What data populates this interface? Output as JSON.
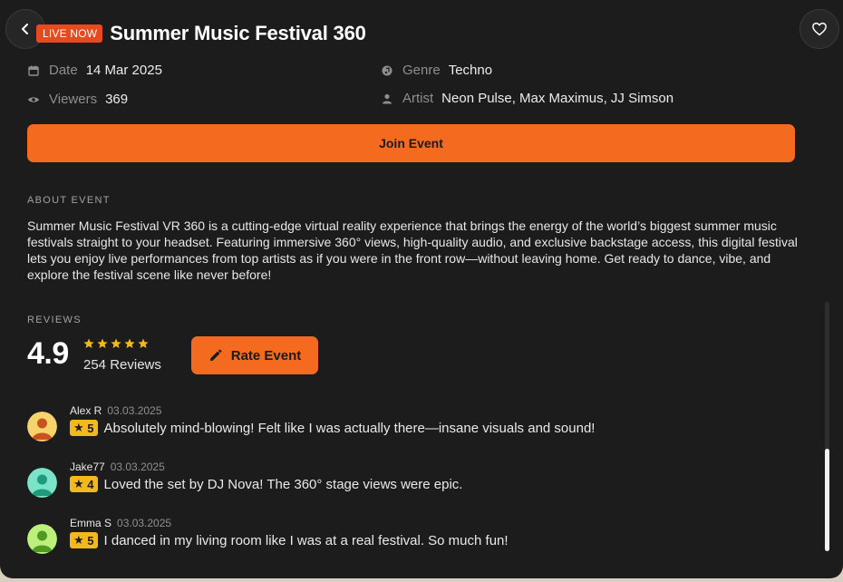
{
  "header": {
    "badge": "LIVE NOW",
    "title": "Summer Music Festival 360"
  },
  "meta": {
    "date": {
      "label": "Date",
      "value": "14 Mar 2025",
      "icon": "calendar-icon"
    },
    "viewers": {
      "label": "Viewers",
      "value": "369",
      "icon": "eye-icon"
    },
    "genre": {
      "label": "Genre",
      "value": "Techno",
      "icon": "music-disc-icon"
    },
    "artist": {
      "label": "Artist",
      "value": "Neon Pulse, Max Maximus, JJ Simson",
      "icon": "person-icon"
    }
  },
  "actions": {
    "join_label": "Join Event",
    "rate_label": "Rate Event"
  },
  "about": {
    "heading": "ABOUT EVENT",
    "text": "Summer Music Festival VR 360 is a cutting-edge virtual reality experience that brings the energy of the world’s biggest summer music festivals straight to your headset. Featuring immersive 360° views, high-quality audio, and exclusive backstage access, this digital festival lets you enjoy live performances from top artists as if you were in the front row—without leaving home. Get ready to dance, vibe, and explore the festival scene like never before!"
  },
  "reviews_section": {
    "heading": "REVIEWS",
    "rating": "4.9",
    "stars": 5,
    "count_text": "254 Reviews"
  },
  "reviews": [
    {
      "name": "Alex R",
      "date": "03.03.2025",
      "rating": "5",
      "text": "Absolutely mind-blowing! Felt like I was actually there—insane visuals and sound!",
      "avatar_color": "#f6d46b"
    },
    {
      "name": "Jake77",
      "date": "03.03.2025",
      "rating": "4",
      "text": "Loved the set by DJ Nova! The 360° stage views were epic.",
      "avatar_color": "#7be3c8"
    },
    {
      "name": "Emma S",
      "date": "03.03.2025",
      "rating": "5",
      "text": "I danced in my living room like I was at a real festival. So much fun!",
      "avatar_color": "#bdf07a"
    }
  ],
  "colors": {
    "accent": "#f46b1f",
    "live_badge": "#e8491d",
    "star": "#f3b81a",
    "panel_bg": "#1c1c1c"
  }
}
